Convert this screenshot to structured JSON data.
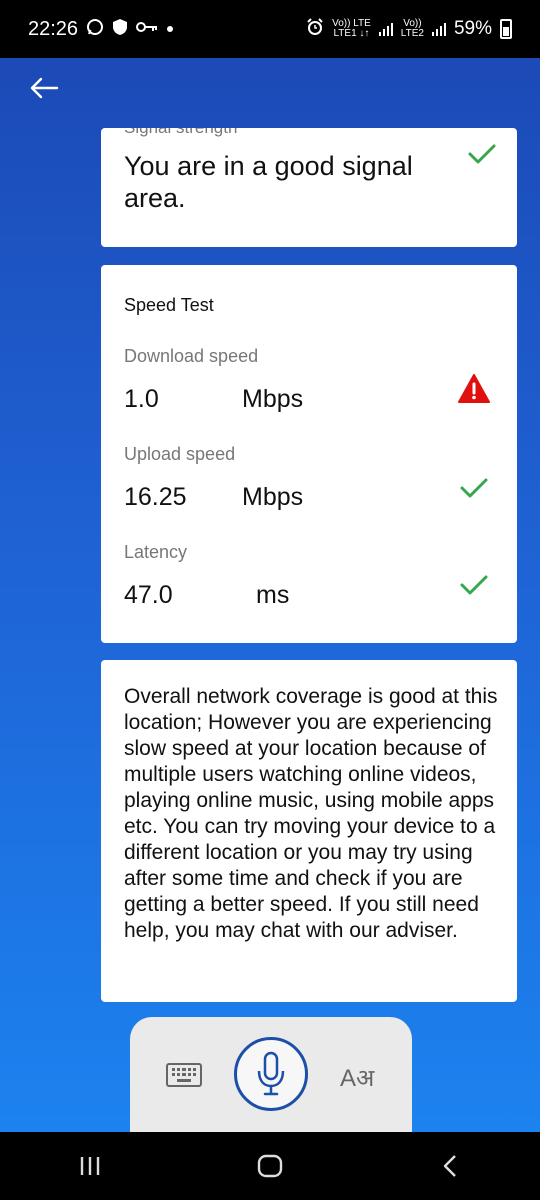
{
  "status_bar": {
    "time": "22:26",
    "battery": "59%",
    "sim1_top": "Vo)) LTE",
    "sim1_bottom": "LTE1 ↓↑",
    "sim2_top": "Vo))",
    "sim2_bottom": "LTE2"
  },
  "header": {
    "back_icon": "arrow-left-icon"
  },
  "signal_card": {
    "label": "Signal strength",
    "message": "You are in a good signal area.",
    "status_icon": "check-icon",
    "accent": "#36a84b"
  },
  "speed_card": {
    "title": "Speed Test",
    "metrics": [
      {
        "label": "Download speed",
        "value": "1.0",
        "unit": "Mbps",
        "status_icon": "warning-icon"
      },
      {
        "label": "Upload speed",
        "value": "16.25",
        "unit": "Mbps",
        "status_icon": "check-icon"
      },
      {
        "label": "Latency",
        "value": "47.0",
        "unit": "ms",
        "status_icon": "check-icon"
      }
    ],
    "warning_color": "#e01010"
  },
  "info_card": {
    "text": "Overall network coverage is good at this location; However you are experiencing slow speed at your location because of multiple users watching online videos, playing online music, using mobile apps etc. You can try moving your device to a different location or you may try using after some time and check if you are getting a better speed. If you still need help, you may chat with our adviser."
  },
  "input_bar": {
    "keyboard_icon": "keyboard-icon",
    "mic_icon": "microphone-icon",
    "language_label": "Aअ"
  },
  "nav_bar": {
    "recents_icon": "recents-icon",
    "home_icon": "home-icon",
    "back_icon": "back-chevron-icon"
  }
}
